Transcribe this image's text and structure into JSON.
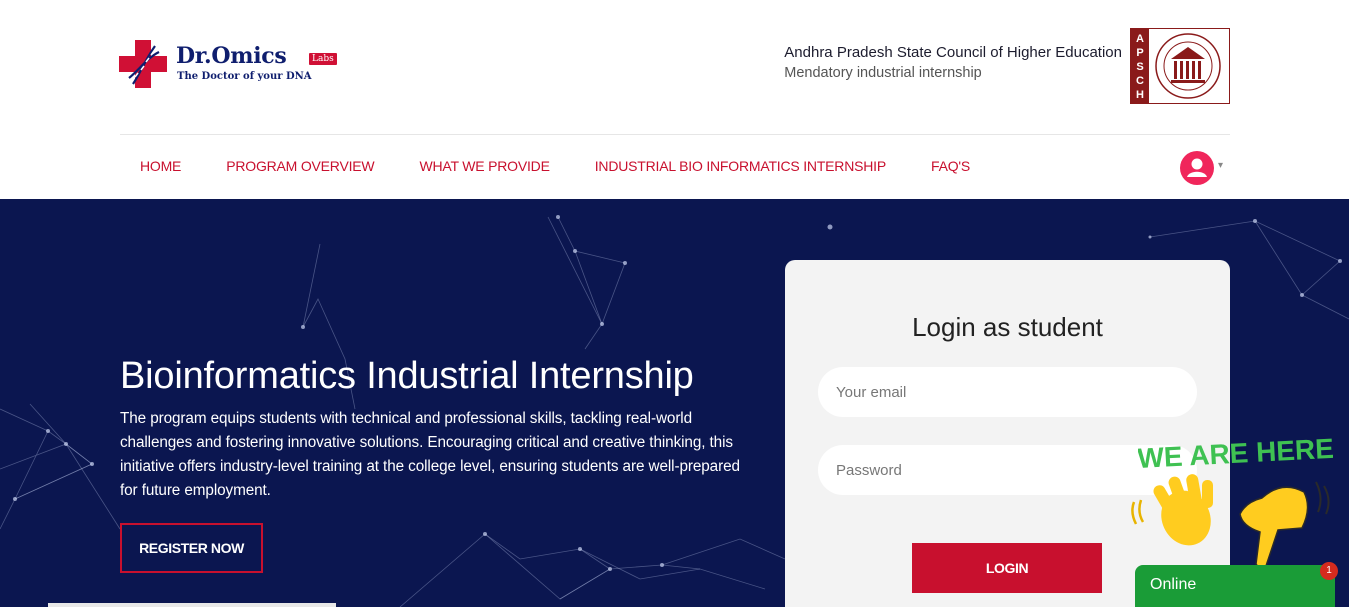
{
  "brand": {
    "name": "Dr.Omics",
    "badge": "Labs",
    "tagline": "The Doctor of your DNA",
    "accent": "#c8102e",
    "navy": "#0f1e6e"
  },
  "council": {
    "name": "Andhra Pradesh State Council of Higher Education",
    "subtitle": "Mendatory industrial internship",
    "seal_letters": "APSCHE"
  },
  "nav": {
    "items": [
      "HOME",
      "PROGRAM OVERVIEW",
      "WHAT WE PROVIDE",
      "INDUSTRIAL BIO INFORMATICS INTERNSHIP",
      "FAQ'S"
    ],
    "user_icon": "user-circle-icon"
  },
  "hero": {
    "title": "Bioinformatics Industrial Internship",
    "description": "The program equips students with technical and professional skills, tackling real-world challenges and fostering innovative solutions. Encouraging critical and creative thinking, this initiative offers industry-level training at the college level, ensuring students are well-prepared for future employment.",
    "cta": "REGISTER NOW",
    "background": "#0b1650"
  },
  "login": {
    "title": "Login as student",
    "email_placeholder": "Your email",
    "password_placeholder": "Password",
    "button": "LOGIN"
  },
  "chat": {
    "banner": "WE ARE HERE!",
    "status": "Online",
    "unread": "1",
    "color": "#1a9c37"
  }
}
